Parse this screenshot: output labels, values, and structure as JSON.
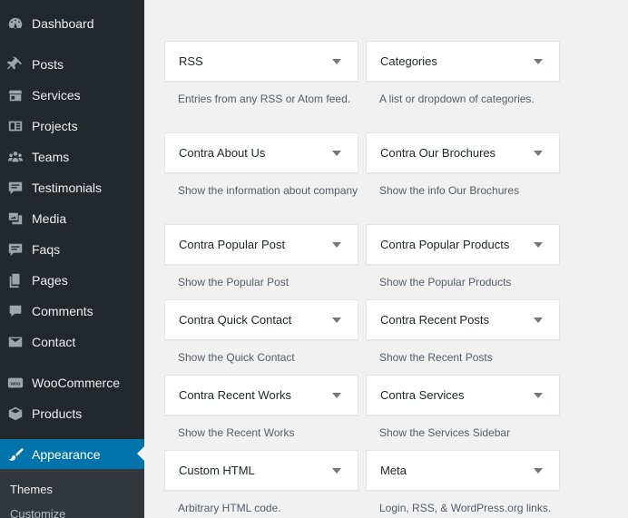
{
  "sidebar": {
    "items": [
      {
        "label": "Dashboard",
        "icon": "dashboard-icon"
      },
      {
        "label": "Posts",
        "icon": "pin-icon"
      },
      {
        "label": "Services",
        "icon": "store-icon"
      },
      {
        "label": "Projects",
        "icon": "portfolio-icon"
      },
      {
        "label": "Teams",
        "icon": "groups-icon"
      },
      {
        "label": "Testimonials",
        "icon": "testimonial-icon"
      },
      {
        "label": "Media",
        "icon": "media-icon"
      },
      {
        "label": "Faqs",
        "icon": "faq-icon"
      },
      {
        "label": "Pages",
        "icon": "pages-icon"
      },
      {
        "label": "Comments",
        "icon": "comment-icon"
      },
      {
        "label": "Contact",
        "icon": "email-icon"
      },
      {
        "label": "WooCommerce",
        "icon": "woocommerce-icon"
      },
      {
        "label": "Products",
        "icon": "products-icon"
      },
      {
        "label": "Appearance",
        "icon": "brush-icon",
        "active": true
      }
    ],
    "submenu": [
      {
        "label": "Themes"
      },
      {
        "label": "Customize"
      }
    ],
    "accent_color": "#0073aa",
    "bg_color": "#23282d"
  },
  "widgets": [
    {
      "title": "RSS",
      "desc": "Entries from any RSS or Atom feed."
    },
    {
      "title": "Categories",
      "desc": "A list or dropdown of categories."
    },
    {
      "title": "Contra About Us",
      "desc": "Show the information about company"
    },
    {
      "title": "Contra Our Brochures",
      "desc": "Show the info Our Brochures"
    },
    {
      "title": "Contra Popular Post",
      "desc": "Show the Popular Post"
    },
    {
      "title": "Contra Popular Products",
      "desc": "Show the Popular Products"
    },
    {
      "title": "Contra Quick Contact",
      "desc": "Show the Quick Contact"
    },
    {
      "title": "Contra Recent Posts",
      "desc": "Show the Recent Posts"
    },
    {
      "title": "Contra Recent Works",
      "desc": "Show the Recent Works"
    },
    {
      "title": "Contra Services",
      "desc": "Show the Services Sidebar"
    },
    {
      "title": "Custom HTML",
      "desc": "Arbitrary HTML code."
    },
    {
      "title": "Meta",
      "desc": "Login, RSS, & WordPress.org links."
    }
  ]
}
